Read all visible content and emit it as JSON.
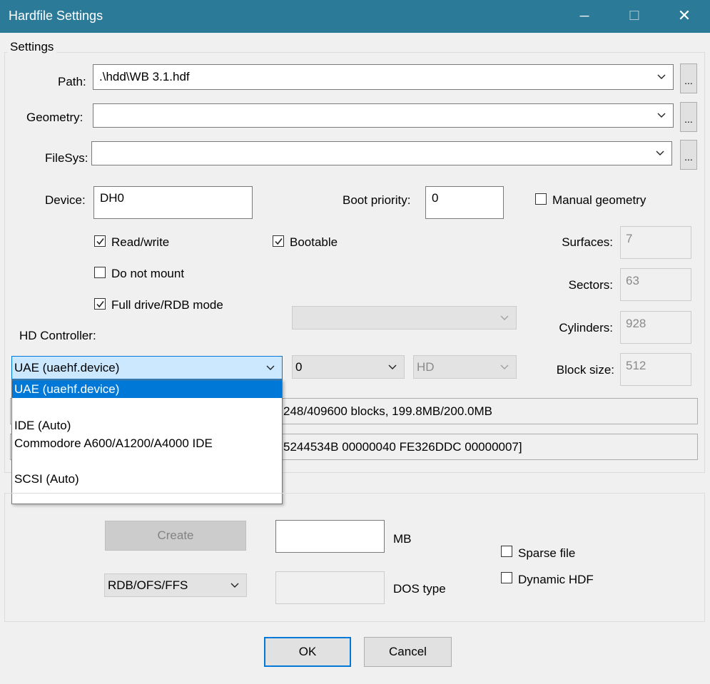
{
  "window": {
    "title": "Hardfile Settings",
    "title_bar_color": "#2b7a98",
    "controls": {
      "minimize": "─",
      "maximize": "☐",
      "close": "✕"
    }
  },
  "settings": {
    "group_label": "Settings",
    "path": {
      "label": "Path:",
      "value": ".\\hdd\\WB 3.1.hdf",
      "browse": "..."
    },
    "geometry": {
      "label": "Geometry:",
      "value": "",
      "browse": "..."
    },
    "filesys": {
      "label": "FileSys:",
      "value": "",
      "browse": "..."
    },
    "device": {
      "label": "Device:",
      "value": "DH0"
    },
    "boot_priority": {
      "label": "Boot priority:",
      "value": "0"
    },
    "manual_geometry": {
      "label": "Manual geometry",
      "checked": false
    },
    "read_write": {
      "label": "Read/write",
      "checked": true
    },
    "bootable": {
      "label": "Bootable",
      "checked": true
    },
    "do_not_mount": {
      "label": "Do not mount",
      "checked": false
    },
    "full_drive": {
      "label": "Full drive/RDB mode",
      "checked": true
    },
    "surfaces": {
      "label": "Surfaces:",
      "value": "7"
    },
    "sectors": {
      "label": "Sectors:",
      "value": "63"
    },
    "cylinders": {
      "label": "Cylinders:",
      "value": "928"
    },
    "block_size": {
      "label": "Block size:",
      "value": "512"
    },
    "hd_controller": {
      "label": "HD Controller:",
      "selected": "UAE (uaehf.device)",
      "options": [
        "UAE (uaehf.device)",
        "",
        "IDE (Auto)",
        "Commodore A600/A1200/A4000 IDE",
        "",
        "SCSI (Auto)"
      ],
      "unit": "0",
      "type": "HD"
    },
    "info_line1": "248/409600 blocks, 199.8MB/200.0MB",
    "info_line2": "5244534B 00000040 FE326DDC 00000007]"
  },
  "create": {
    "create_button": "Create",
    "size_value": "",
    "size_unit": "MB",
    "fs_type": "RDB/OFS/FFS",
    "dos_type_value": "",
    "dos_type_label": "DOS type",
    "sparse_file": {
      "label": "Sparse file",
      "checked": false
    },
    "dynamic_hdf": {
      "label": "Dynamic HDF",
      "checked": false
    }
  },
  "buttons": {
    "ok": "OK",
    "cancel": "Cancel"
  }
}
